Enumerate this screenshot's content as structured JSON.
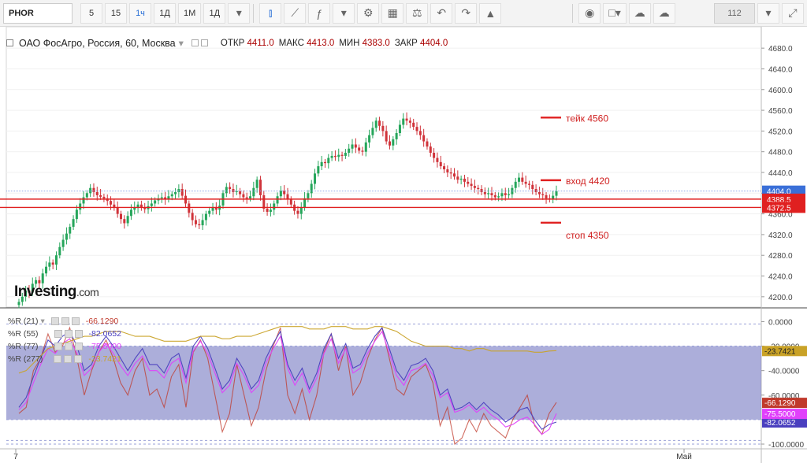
{
  "toolbar": {
    "symbol": "PHOR",
    "intervals": [
      "5",
      "15",
      "1ч",
      "1Д",
      "1М",
      "1Д"
    ],
    "active_interval_index": 2,
    "zoom_value": "112"
  },
  "legend": {
    "title": "ОАО ФосАгро, Россия, 60, Москва",
    "open_label": "ОТКР",
    "open_value": "4411.0",
    "high_label": "МАКС",
    "high_value": "4413.0",
    "low_label": "МИН",
    "low_value": "4383.0",
    "close_label": "ЗАКР",
    "close_value": "4404.0"
  },
  "watermark": {
    "brand": "Investing",
    "suffix": ".com"
  },
  "indicator_legend": [
    {
      "label": "%R (21)",
      "value": "-66.1290",
      "color": "#c0392b"
    },
    {
      "label": "%R (55)",
      "value": "-82.0652",
      "color": "#4a3fbf"
    },
    {
      "label": "%R (77)",
      "value": "-75.5000",
      "color": "#e040fb"
    },
    {
      "label": "%R (277)",
      "value": "-23.7421",
      "color": "#c9a227"
    }
  ],
  "colors": {
    "up": "#26a65b",
    "down": "#d0333a",
    "level": "#e02020",
    "band": "#7f82c6"
  },
  "chart_data": {
    "type": "candlestick",
    "price_axis": {
      "ylim": [
        4180,
        4700
      ],
      "ticks": [
        4200,
        4240,
        4280,
        4320,
        4360,
        4400,
        4440,
        4480,
        4520,
        4560,
        4600,
        4640,
        4680
      ],
      "tick_labels": [
        "4200.0",
        "4240.0",
        "4280.0",
        "4320.0",
        "4360.0",
        "4400.0",
        "4440.0",
        "4480.0",
        "4520.0",
        "4560.0",
        "4600.0",
        "4640.0",
        "4680.0"
      ]
    },
    "current_price": "4404.0",
    "horizontal_levels": [
      {
        "value": 4388.5,
        "label": "4388.5"
      },
      {
        "value": 4372.5,
        "label": "4372.5"
      }
    ],
    "annotations": [
      {
        "text": "тейк 4560",
        "price": 4546
      },
      {
        "text": "вход 4420",
        "price": 4425
      },
      {
        "text": "стоп 4350",
        "price": 4343
      }
    ],
    "x_labels": [
      {
        "text": "7",
        "index": 0
      },
      {
        "text": "Май",
        "index": 190
      }
    ],
    "candles_close": [
      4190,
      4200,
      4212,
      4208,
      4225,
      4232,
      4226,
      4245,
      4258,
      4266,
      4262,
      4280,
      4296,
      4310,
      4322,
      4335,
      4350,
      4368,
      4380,
      4392,
      4400,
      4410,
      4402,
      4396,
      4393,
      4390,
      4385,
      4378,
      4372,
      4360,
      4350,
      4342,
      4356,
      4368,
      4372,
      4378,
      4372,
      4369,
      4375,
      4380,
      4386,
      4390,
      4392,
      4388,
      4394,
      4398,
      4402,
      4408,
      4395,
      4380,
      4362,
      4348,
      4340,
      4338,
      4348,
      4360,
      4366,
      4372,
      4368,
      4376,
      4400,
      4412,
      4408,
      4402,
      4404,
      4398,
      4392,
      4390,
      4394,
      4410,
      4426,
      4396,
      4370,
      4364,
      4368,
      4380,
      4394,
      4405,
      4398,
      4388,
      4378,
      4366,
      4360,
      4372,
      4390,
      4400,
      4418,
      4438,
      4452,
      4460,
      4458,
      4468,
      4472,
      4470,
      4474,
      4472,
      4478,
      4486,
      4494,
      4488,
      4482,
      4480,
      4498,
      4512,
      4526,
      4540,
      4530,
      4520,
      4500,
      4492,
      4504,
      4516,
      4532,
      4544,
      4540,
      4536,
      4528,
      4520,
      4512,
      4500,
      4490,
      4478,
      4468,
      4460,
      4452,
      4446,
      4440,
      4438,
      4432,
      4426,
      4428,
      4422,
      4418,
      4414,
      4410,
      4408,
      4402,
      4398,
      4400,
      4396,
      4392,
      4394,
      4400,
      4396,
      4398,
      4410,
      4422,
      4430,
      4422,
      4418,
      4416,
      4408,
      4402,
      4398,
      4396,
      4390,
      4388,
      4395,
      4404
    ],
    "williams_axis": {
      "ylim": [
        -100,
        8
      ],
      "ticks": [
        0,
        -20,
        -40,
        -60,
        -80,
        -100
      ],
      "tick_labels": [
        "0.0000",
        "-20.0000",
        "-40.0000",
        "-60.0000",
        "-80.0000",
        "-100.0000"
      ]
    },
    "williams_band": [
      -20,
      -80
    ],
    "series": [
      {
        "name": "%R (21)",
        "values": [
          -75,
          -70,
          -40,
          -30,
          -10,
          -25,
          -20,
          -5,
          -30,
          -60,
          -40,
          -25,
          -15,
          -30,
          -50,
          -60,
          -40,
          -30,
          -60,
          -55,
          -70,
          -45,
          -35,
          -70,
          -25,
          -15,
          -30,
          -60,
          -90,
          -75,
          -35,
          -60,
          -85,
          -70,
          -40,
          -20,
          -5,
          -60,
          -75,
          -55,
          -80,
          -60,
          -25,
          -10,
          -40,
          -20,
          -60,
          -50,
          -30,
          -15,
          -5,
          -30,
          -55,
          -60,
          -45,
          -40,
          -35,
          -50,
          -85,
          -70,
          -100,
          -95,
          -80,
          -90,
          -75,
          -85,
          -90,
          -95,
          -80,
          -70,
          -60,
          -85,
          -92,
          -75,
          -66
        ]
      },
      {
        "name": "%R (55)",
        "values": [
          -70,
          -62,
          -45,
          -30,
          -15,
          -20,
          -12,
          -8,
          -20,
          -40,
          -35,
          -20,
          -12,
          -20,
          -30,
          -40,
          -30,
          -22,
          -35,
          -35,
          -42,
          -30,
          -26,
          -46,
          -20,
          -12,
          -22,
          -38,
          -55,
          -48,
          -30,
          -40,
          -55,
          -48,
          -30,
          -18,
          -8,
          -35,
          -48,
          -38,
          -55,
          -42,
          -22,
          -10,
          -30,
          -18,
          -38,
          -35,
          -22,
          -12,
          -5,
          -22,
          -40,
          -48,
          -36,
          -34,
          -30,
          -40,
          -60,
          -55,
          -72,
          -70,
          -66,
          -72,
          -66,
          -72,
          -76,
          -82,
          -78,
          -72,
          -70,
          -80,
          -88,
          -84,
          -82
        ]
      },
      {
        "name": "%R (77)",
        "values": [
          -72,
          -66,
          -50,
          -35,
          -22,
          -26,
          -18,
          -14,
          -26,
          -44,
          -38,
          -25,
          -18,
          -26,
          -36,
          -44,
          -34,
          -28,
          -40,
          -40,
          -46,
          -34,
          -30,
          -50,
          -24,
          -16,
          -26,
          -42,
          -58,
          -52,
          -34,
          -44,
          -58,
          -52,
          -34,
          -22,
          -12,
          -38,
          -52,
          -42,
          -58,
          -46,
          -26,
          -14,
          -34,
          -22,
          -42,
          -38,
          -26,
          -16,
          -8,
          -26,
          -44,
          -52,
          -40,
          -38,
          -34,
          -44,
          -62,
          -58,
          -74,
          -72,
          -68,
          -74,
          -70,
          -76,
          -80,
          -86,
          -84,
          -80,
          -78,
          -84,
          -92,
          -88,
          -75
        ]
      },
      {
        "name": "%R (277)",
        "values": [
          -42,
          -40,
          -34,
          -28,
          -22,
          -20,
          -18,
          -16,
          -14,
          -12,
          -12,
          -10,
          -8,
          -8,
          -8,
          -10,
          -12,
          -12,
          -12,
          -14,
          -16,
          -16,
          -16,
          -16,
          -14,
          -12,
          -12,
          -12,
          -14,
          -14,
          -12,
          -12,
          -12,
          -10,
          -8,
          -6,
          -4,
          -4,
          -4,
          -4,
          -6,
          -6,
          -6,
          -4,
          -4,
          -4,
          -6,
          -6,
          -6,
          -4,
          -4,
          -6,
          -8,
          -12,
          -16,
          -18,
          -20,
          -20,
          -20,
          -20,
          -22,
          -22,
          -24,
          -22,
          -22,
          -24,
          -24,
          -24,
          -24,
          -24,
          -24,
          -25,
          -25,
          -24,
          -23.7
        ]
      }
    ]
  }
}
